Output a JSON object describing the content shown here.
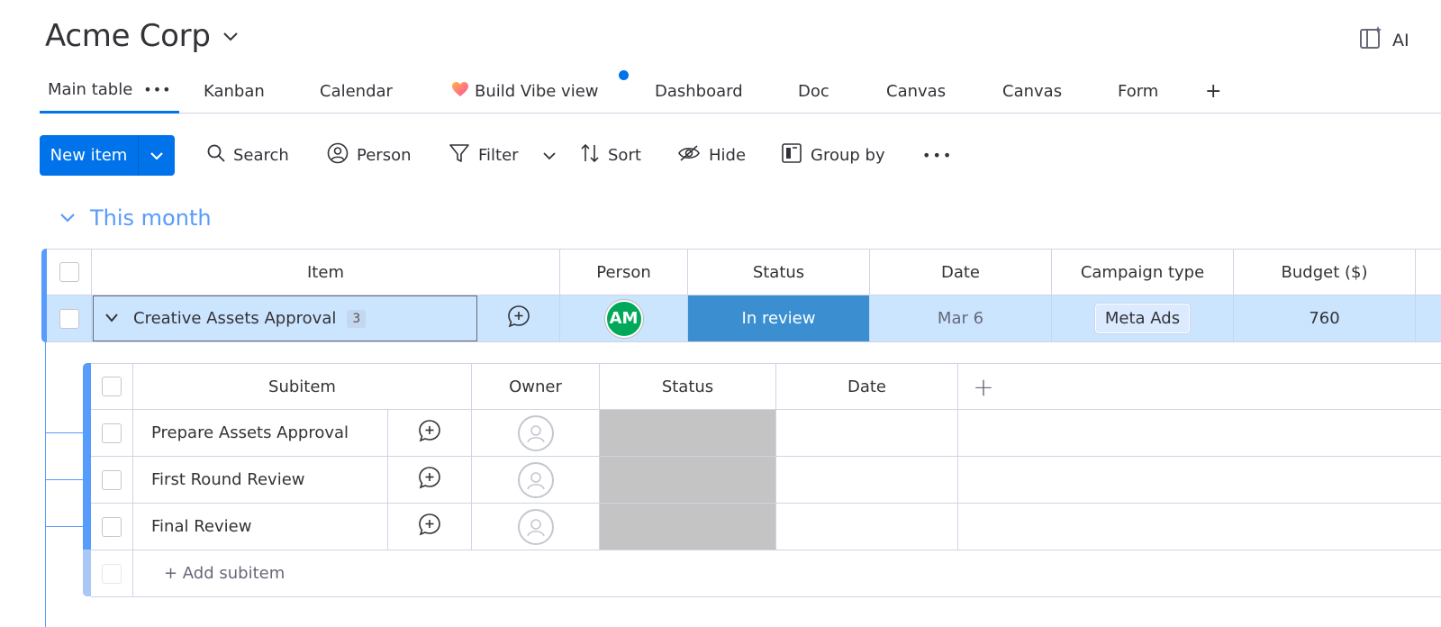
{
  "header": {
    "board_title": "Acme Corp",
    "ai_label": "AI"
  },
  "tabs": [
    {
      "label": "Main table",
      "active": true
    },
    {
      "label": "Kanban"
    },
    {
      "label": "Calendar"
    },
    {
      "label": "Build Vibe view"
    },
    {
      "label": "Dashboard"
    },
    {
      "label": "Doc"
    },
    {
      "label": "Canvas"
    },
    {
      "label": "Canvas"
    },
    {
      "label": "Form"
    },
    {
      "label": "+"
    }
  ],
  "toolbar": {
    "new_item": "New item",
    "search": "Search",
    "person": "Person",
    "filter": "Filter",
    "sort": "Sort",
    "hide": "Hide",
    "group_by": "Group by"
  },
  "group": {
    "title": "This month",
    "color": "#579bfc",
    "columns": [
      "Item",
      "Person",
      "Status",
      "Date",
      "Campaign type",
      "Budget ($)"
    ],
    "item": {
      "name": "Creative Assets Approval",
      "subitem_count": "3",
      "person_initials": "AM",
      "status": "In review",
      "status_color": "#3b8fd1",
      "date": "Mar 6",
      "campaign_type": "Meta Ads",
      "budget": "760"
    }
  },
  "subitems": {
    "columns": [
      "Subitem",
      "Owner",
      "Status",
      "Date"
    ],
    "add_column": "+",
    "rows": [
      {
        "name": "Prepare Assets Approval"
      },
      {
        "name": "First Round Review"
      },
      {
        "name": "Final Review"
      }
    ],
    "add_label": "+ Add subitem"
  }
}
